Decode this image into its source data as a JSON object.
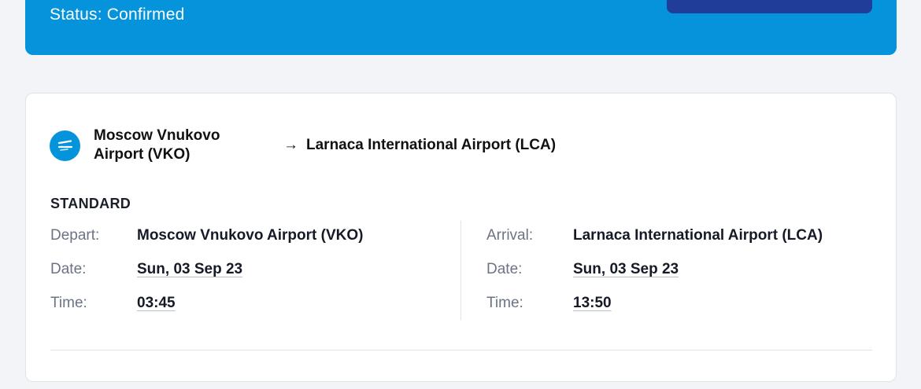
{
  "booking": {
    "status_text": "Status: Confirmed",
    "colors": {
      "banner": "#0594db",
      "button": "#1f3d99"
    }
  },
  "flight": {
    "airline_icon": "airline-logo-icon",
    "from": "Moscow Vnukovo Airport (VKO)",
    "arrow": "→",
    "to": "Larnaca International Airport (LCA)",
    "fare_class": "STANDARD",
    "departure": {
      "label_depart": "Depart:",
      "airport": "Moscow Vnukovo Airport (VKO)",
      "label_date": "Date:",
      "date": "Sun, 03 Sep 23",
      "label_time": "Time:",
      "time": "03:45"
    },
    "arrival": {
      "label_arrival": "Arrival:",
      "airport": "Larnaca International Airport (LCA)",
      "label_date": "Date:",
      "date": "Sun, 03 Sep 23",
      "label_time": "Time:",
      "time": "13:50"
    }
  }
}
